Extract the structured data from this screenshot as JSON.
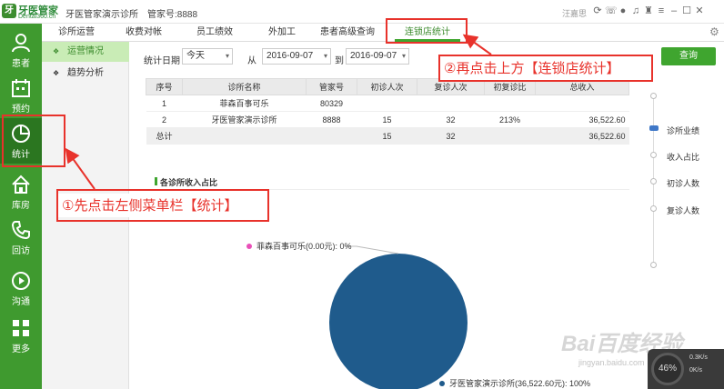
{
  "titlebar": {
    "logo_icon": "牙",
    "logo_text": "牙医管家",
    "logo_sub": "Dental360.cn",
    "clinic_name": "牙医管家演示诊所",
    "account_no": "管家号:8888",
    "user_name": "汪嘉思"
  },
  "sidebar": {
    "items": [
      {
        "label": "患者",
        "icon": "person-icon"
      },
      {
        "label": "预约",
        "icon": "calendar-icon"
      },
      {
        "label": "统计",
        "icon": "pie-chart-icon"
      },
      {
        "label": "库房",
        "icon": "house-icon"
      },
      {
        "label": "回访",
        "icon": "phone-icon"
      },
      {
        "label": "沟通",
        "icon": "play-icon"
      },
      {
        "label": "更多",
        "icon": "grid-icon"
      }
    ]
  },
  "submenu": {
    "items": [
      {
        "label": "运营情况"
      },
      {
        "label": "趋势分析"
      }
    ]
  },
  "tabs": [
    {
      "label": "诊所运营"
    },
    {
      "label": "收费对帐"
    },
    {
      "label": "员工绩效"
    },
    {
      "label": "外加工"
    },
    {
      "label": "患者高级查询"
    },
    {
      "label": "连锁店统计"
    }
  ],
  "filters": {
    "date_label": "统计日期",
    "period_value": "今天",
    "from_label": "从",
    "from_date": "2016-09-07",
    "to_label": "到",
    "to_date": "2016-09-07",
    "query_button": "查询"
  },
  "table": {
    "headers": [
      "序号",
      "诊所名称",
      "管家号",
      "初诊人次",
      "复诊人次",
      "初复诊比",
      "总收入"
    ],
    "rows": [
      [
        "1",
        "菲森百事可乐",
        "80329",
        "",
        "",
        "",
        ""
      ],
      [
        "2",
        "牙医管家演示诊所",
        "8888",
        "15",
        "32",
        "213%",
        "36,522.60"
      ]
    ],
    "total": [
      "总计",
      "",
      "",
      "15",
      "32",
      "",
      "36,522.60"
    ]
  },
  "right_nav": {
    "items": [
      {
        "label": "诊所业绩"
      },
      {
        "label": "收入占比"
      },
      {
        "label": "初诊人数"
      },
      {
        "label": "复诊人数"
      }
    ]
  },
  "chart_data": {
    "type": "pie",
    "title": "各诊所收入占比",
    "categories": [
      "菲森百事可乐",
      "牙医管家演示诊所"
    ],
    "values": [
      0.0,
      36522.6
    ],
    "percent": [
      0,
      100
    ],
    "labels": [
      "菲森百事可乐(0.00元): 0%",
      "牙医管家演示诊所(36,522.60元): 100%"
    ],
    "colors": [
      "#e94fb8",
      "#1f5b8c"
    ]
  },
  "annotations": {
    "step1": "①先点击左侧菜单栏【统计】",
    "step2": "②再点击上方【连锁店统计】",
    "color": "#e8322b"
  },
  "watermark": {
    "text": "Bai百度经验",
    "sub": "jingyan.baidu.com"
  },
  "widget": {
    "percent": "46%",
    "line1": "0.3K/s",
    "line2": "0K/s"
  }
}
